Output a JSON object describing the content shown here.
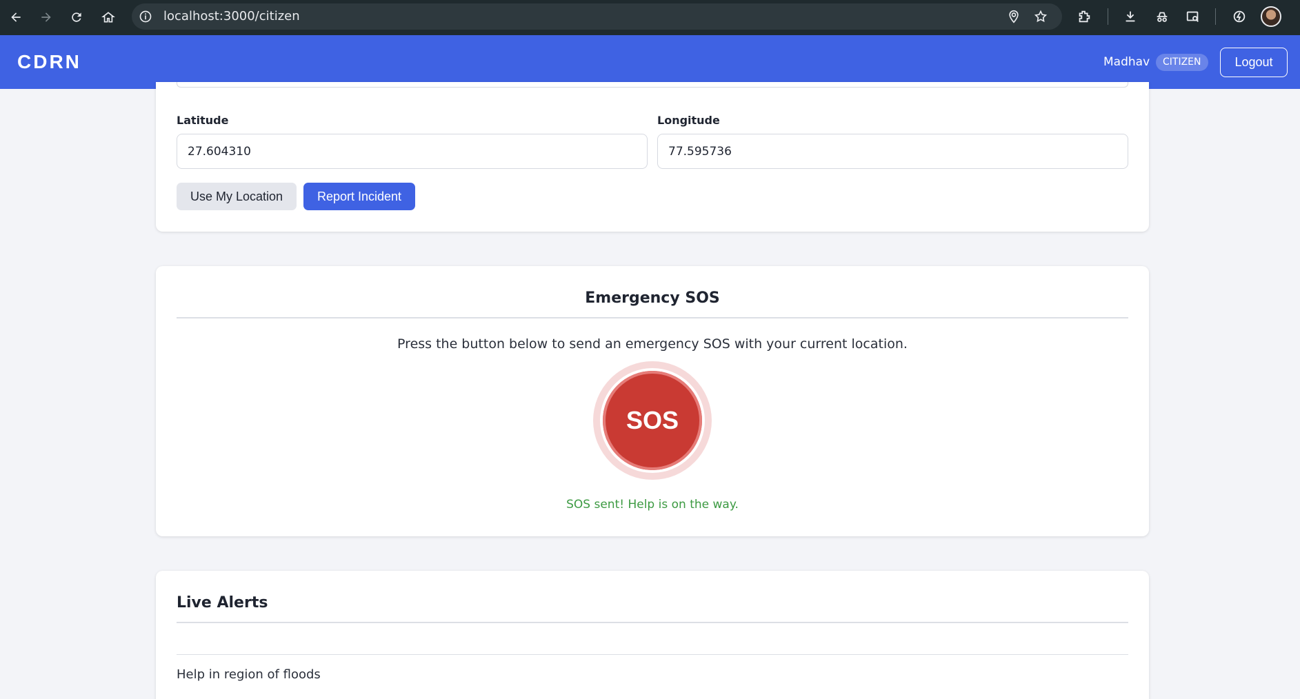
{
  "browser": {
    "url": "localhost:3000/citizen",
    "icons": [
      "back-icon",
      "forward-icon",
      "reload-icon",
      "home-icon",
      "info-icon",
      "location-icon",
      "star-icon",
      "extensions-icon",
      "download-icon",
      "incognito-icon",
      "search-tab-icon",
      "performance-icon",
      "profile-avatar"
    ]
  },
  "header": {
    "brand": "CDRN",
    "username": "Madhav",
    "role": "CITIZEN",
    "logout_label": "Logout",
    "color": "#3f62e3"
  },
  "incident_form": {
    "latitude_label": "Latitude",
    "latitude_value": "27.604310",
    "longitude_label": "Longitude",
    "longitude_value": "77.595736",
    "use_location_label": "Use My Location",
    "report_label": "Report Incident"
  },
  "sos": {
    "title": "Emergency SOS",
    "description": "Press the button below to send an emergency SOS with your current location.",
    "button_label": "SOS",
    "status": "SOS sent! Help is on the way.",
    "button_color": "#c93a33",
    "status_color": "#3c9a42"
  },
  "alerts": {
    "title": "Live Alerts",
    "items": [
      "Help in region of floods"
    ]
  }
}
